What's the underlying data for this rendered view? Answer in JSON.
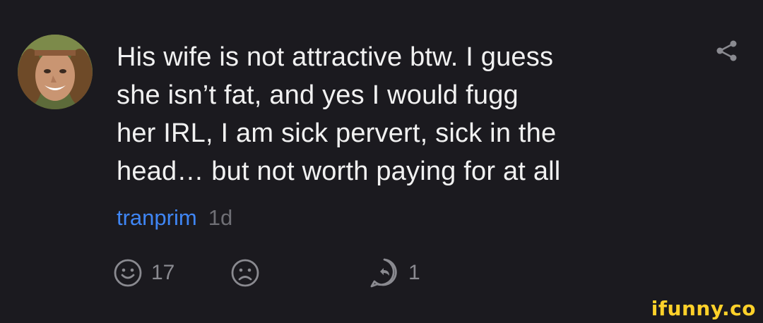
{
  "comment": {
    "text_lines": [
      "His wife is not attractive btw. I guess",
      "she isn’t fat, and yes I would fugg",
      "her IRL, I am sick pervert, sick in the",
      "head… but not worth paying for at all"
    ],
    "username": "tranprim",
    "timestamp": "1d",
    "share_icon": "share-icon"
  },
  "actions": {
    "smile_count": "17",
    "frown_count": "",
    "reply_count": "1"
  },
  "watermark": "ifunny.co",
  "colors": {
    "background": "#1b1a1f",
    "text": "#f1f1f1",
    "username": "#3f86f5",
    "muted": "#6f6f75",
    "watermark": "#ffd12a"
  }
}
